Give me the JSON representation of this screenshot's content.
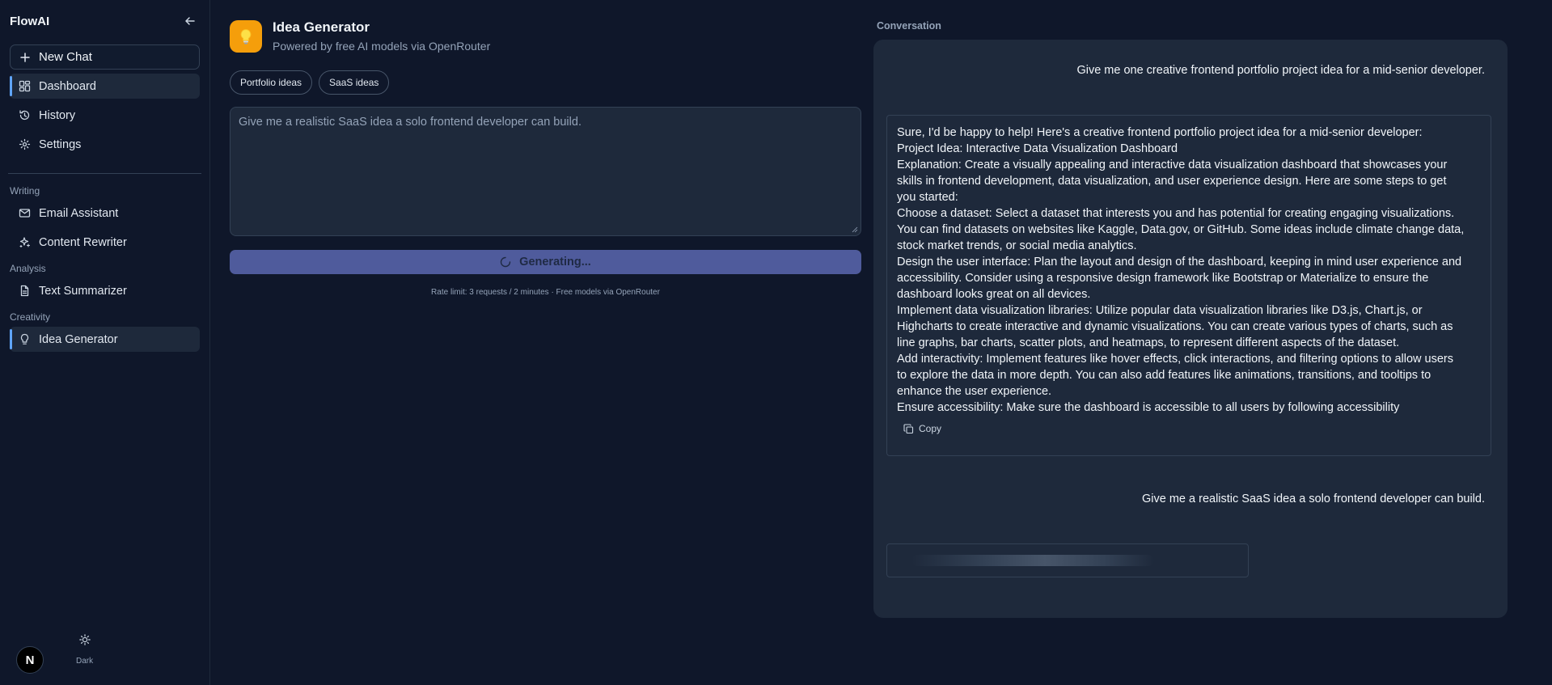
{
  "sidebar": {
    "brand": "FlowAI",
    "new_chat_label": "New Chat",
    "top_items": [
      {
        "label": "Dashboard",
        "icon": "grid-icon",
        "active": true
      },
      {
        "label": "History",
        "icon": "history-icon",
        "active": false
      },
      {
        "label": "Settings",
        "icon": "gear-icon",
        "active": false
      }
    ],
    "sections": [
      {
        "label": "Writing",
        "items": [
          {
            "label": "Email Assistant",
            "icon": "mail-icon"
          },
          {
            "label": "Content Rewriter",
            "icon": "sparkles-icon"
          }
        ]
      },
      {
        "label": "Analysis",
        "items": [
          {
            "label": "Text Summarizer",
            "icon": "document-icon"
          }
        ]
      },
      {
        "label": "Creativity",
        "items": [
          {
            "label": "Idea Generator",
            "icon": "lightbulb-icon",
            "active": true
          }
        ]
      }
    ],
    "avatar_letter": "N",
    "theme_label": "Dark"
  },
  "tool": {
    "title": "Idea Generator",
    "subtitle": "Powered by free AI models via OpenRouter",
    "chips": [
      "Portfolio ideas",
      "SaaS ideas"
    ],
    "prompt_value": "Give me a realistic SaaS idea a solo frontend developer can build.",
    "generate_label": "Generating...",
    "rate_limit": "Rate limit: 3 requests / 2 minutes · Free models via OpenRouter"
  },
  "conversation": {
    "title": "Conversation",
    "messages": [
      {
        "role": "user",
        "text": "Give me one creative frontend portfolio project idea for a mid-senior developer."
      },
      {
        "role": "assistant",
        "lines": [
          "Sure, I'd be happy to help! Here's a creative frontend portfolio project idea for a mid-senior developer:",
          "Project Idea: Interactive Data Visualization Dashboard",
          "Explanation: Create a visually appealing and interactive data visualization dashboard that showcases your",
          "skills in frontend development, data visualization, and user experience design. Here are some steps to get",
          "you started:",
          "Choose a dataset: Select a dataset that interests you and has potential for creating engaging visualizations.",
          "You can find datasets on websites like Kaggle, Data.gov, or GitHub. Some ideas include climate change data,",
          "stock market trends, or social media analytics.",
          "Design the user interface: Plan the layout and design of the dashboard, keeping in mind user experience and",
          "accessibility. Consider using a responsive design framework like Bootstrap or Materialize to ensure the",
          "dashboard looks great on all devices.",
          "Implement data visualization libraries: Utilize popular data visualization libraries like D3.js, Chart.js, or",
          "Highcharts to create interactive and dynamic visualizations. You can create various types of charts, such as",
          "line graphs, bar charts, scatter plots, and heatmaps, to represent different aspects of the dataset.",
          "Add interactivity: Implement features like hover effects, click interactions, and filtering options to allow users",
          "to explore the data in more depth. You can also add features like animations, transitions, and tooltips to",
          "enhance the user experience.",
          "Ensure accessibility: Make sure the dashboard is accessible to all users by following accessibility"
        ],
        "copy_label": "Copy"
      },
      {
        "role": "user",
        "text": "Give me a realistic SaaS idea a solo frontend developer can build."
      }
    ]
  }
}
